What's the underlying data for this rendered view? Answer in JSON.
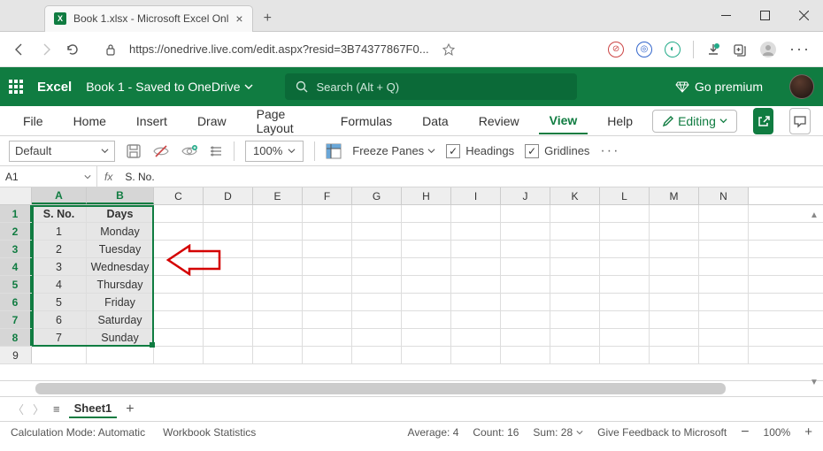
{
  "browser": {
    "tab_title": "Book 1.xlsx - Microsoft Excel Onl",
    "url": "https://onedrive.live.com/edit.aspx?resid=3B74377867F0..."
  },
  "header": {
    "app_name": "Excel",
    "doc_status": "Book 1 - Saved to OneDrive",
    "search_placeholder": "Search (Alt + Q)",
    "premium_label": "Go premium"
  },
  "ribbon_tabs": {
    "file": "File",
    "home": "Home",
    "insert": "Insert",
    "draw": "Draw",
    "page_layout": "Page Layout",
    "formulas": "Formulas",
    "data": "Data",
    "review": "Review",
    "view": "View",
    "help": "Help",
    "editing": "Editing"
  },
  "ribbon": {
    "style_default": "Default",
    "zoom": "100%",
    "freeze": "Freeze Panes",
    "headings": "Headings",
    "gridlines": "Gridlines"
  },
  "namebox": {
    "ref": "A1",
    "formula": "S. No."
  },
  "columns": [
    "A",
    "B",
    "C",
    "D",
    "E",
    "F",
    "G",
    "H",
    "I",
    "J",
    "K",
    "L",
    "M",
    "N"
  ],
  "col_widths": {
    "A": 62,
    "B": 76,
    "other": 56
  },
  "rows": [
    {
      "r": 1,
      "a": "S. No.",
      "b": "Days",
      "hdr": true
    },
    {
      "r": 2,
      "a": "1",
      "b": "Monday"
    },
    {
      "r": 3,
      "a": "2",
      "b": "Tuesday"
    },
    {
      "r": 4,
      "a": "3",
      "b": "Wednesday"
    },
    {
      "r": 5,
      "a": "4",
      "b": "Thursday"
    },
    {
      "r": 6,
      "a": "5",
      "b": "Friday"
    },
    {
      "r": 7,
      "a": "6",
      "b": "Saturday"
    },
    {
      "r": 8,
      "a": "7",
      "b": "Sunday"
    },
    {
      "r": 9,
      "a": "",
      "b": ""
    }
  ],
  "sheet": {
    "name": "Sheet1"
  },
  "statusbar": {
    "calc_mode": "Calculation Mode: Automatic",
    "wb_stats": "Workbook Statistics",
    "average": "Average: 4",
    "count": "Count: 16",
    "sum": "Sum: 28",
    "feedback": "Give Feedback to Microsoft",
    "zoom": "100%"
  }
}
